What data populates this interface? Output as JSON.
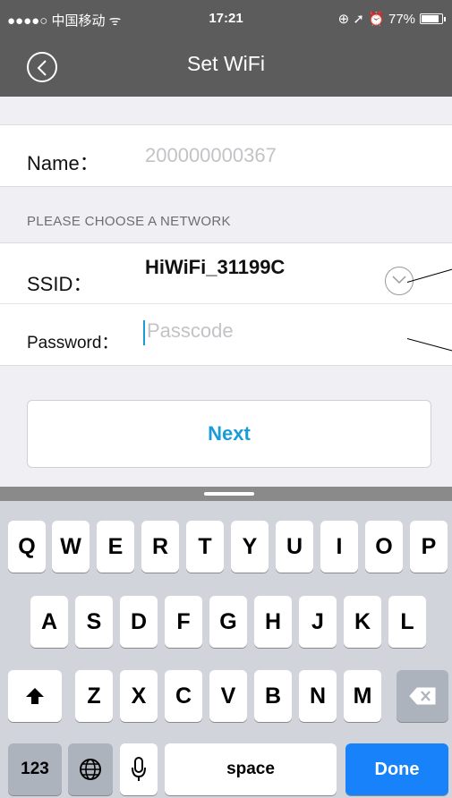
{
  "status_bar": {
    "carrier": "●●●●○ 中国移动 ᯤ",
    "time": "17:21",
    "indicators": "⊕ ➚ ⏰ 77%",
    "battery_level": 0.77
  },
  "nav": {
    "title": "Set WiFi",
    "back_icon": "chevron-left-circle-icon"
  },
  "form": {
    "name_label": "Name：",
    "name_value": "200000000367",
    "section_header": "PLEASE CHOOSE A NETWORK",
    "ssid_label": "SSID：",
    "ssid_value": "HiWiFi_31199C",
    "password_label": "Password：",
    "password_placeholder": "Passcode"
  },
  "next_button": "Next",
  "keyboard": {
    "row1": [
      "Q",
      "W",
      "E",
      "R",
      "T",
      "Y",
      "U",
      "I",
      "O",
      "P"
    ],
    "row2": [
      "A",
      "S",
      "D",
      "F",
      "G",
      "H",
      "J",
      "K",
      "L"
    ],
    "row3": [
      "Z",
      "X",
      "C",
      "V",
      "B",
      "N",
      "M"
    ],
    "shift_icon": "shift-arrow-icon",
    "delete_icon": "backspace-icon",
    "numbers_label": "123",
    "globe_icon": "globe-icon",
    "mic_icon": "microphone-icon",
    "space_label": "space",
    "done_label": "Done"
  },
  "colors": {
    "nav_bg": "#5c5c5c",
    "accent": "#1a9cd8",
    "done_key": "#1882fb"
  }
}
